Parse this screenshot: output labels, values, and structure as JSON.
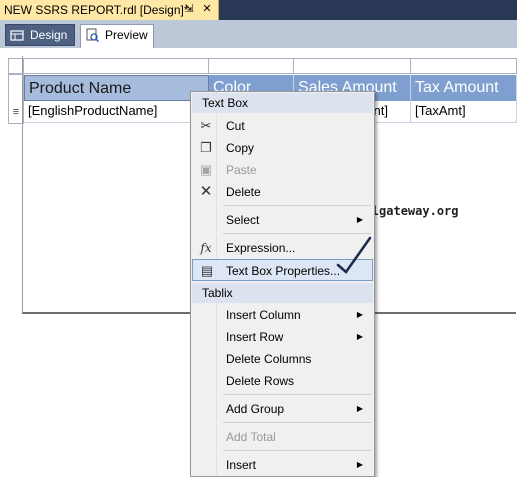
{
  "document_tab": {
    "title": "NEW SSRS REPORT.rdl [Design]*",
    "pin_icon": "pin-icon",
    "close_icon": "close-icon",
    "pin_glyph": "⇲",
    "close_glyph": "✕"
  },
  "view_tabs": [
    {
      "label": "Design",
      "icon": "design-icon"
    },
    {
      "label": "Preview",
      "icon": "preview-icon"
    }
  ],
  "tablix": {
    "headers": [
      "Product Name",
      "Color",
      "Sales Amount",
      "Tax Amount"
    ],
    "row": [
      "[EnglishProductName]",
      "",
      "nt]",
      "[TaxAmt]"
    ]
  },
  "watermark": "©tutorialgateway.org",
  "context_menu": {
    "section1_title": "Text Box",
    "items1": [
      {
        "label": "Cut",
        "icon": "scissors-icon",
        "glyph": "✂",
        "enabled": true
      },
      {
        "label": "Copy",
        "icon": "copy-icon",
        "glyph": "❐",
        "enabled": true
      },
      {
        "label": "Paste",
        "icon": "paste-icon",
        "glyph": "📋",
        "enabled": false
      },
      {
        "label": "Delete",
        "icon": "delete-icon",
        "glyph": "✕",
        "enabled": true
      },
      {
        "label": "Select",
        "submenu": true,
        "enabled": true
      },
      {
        "label": "Expression...",
        "icon": "fx-icon",
        "glyph": "fx",
        "enabled": true
      },
      {
        "label": "Text Box Properties...",
        "icon": "properties-icon",
        "glyph": "▤",
        "enabled": true
      }
    ],
    "section2_title": "Tablix",
    "items2": [
      {
        "label": "Insert Column",
        "submenu": true,
        "enabled": true
      },
      {
        "label": "Insert Row",
        "submenu": true,
        "enabled": true
      },
      {
        "label": "Delete Columns",
        "enabled": true
      },
      {
        "label": "Delete Rows",
        "enabled": true
      },
      {
        "label": "Add Group",
        "submenu": true,
        "enabled": true
      },
      {
        "label": "Add Total",
        "enabled": false
      },
      {
        "label": "Insert",
        "submenu": true,
        "enabled": true
      }
    ],
    "submenu_arrow": "▶"
  },
  "colors": {
    "header_fill": "#7f9fd0",
    "menu_header_fill": "#dde3ee",
    "tab_strip": "#293955",
    "active_doc_tab": "#ffe8a6"
  }
}
